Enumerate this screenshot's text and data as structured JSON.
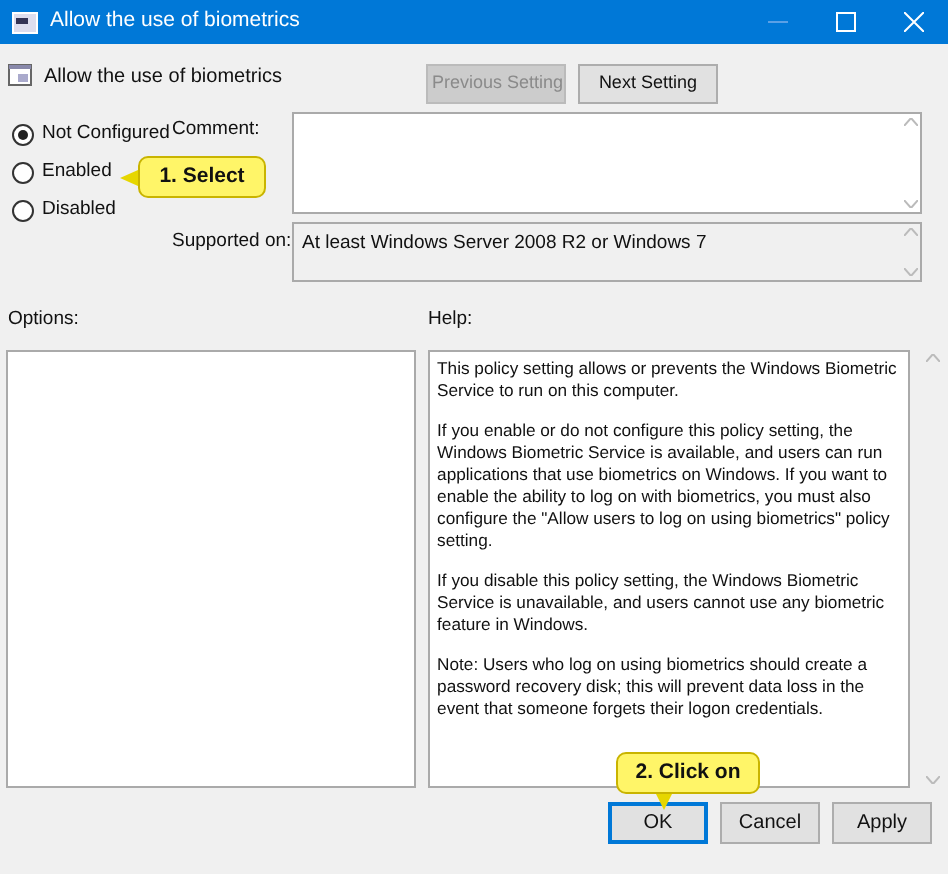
{
  "window": {
    "title": "Allow the use of biometrics"
  },
  "header": {
    "title": "Allow the use of biometrics",
    "buttons": [
      {
        "label": "Previous Setting",
        "disabled": true
      },
      {
        "label": "Next Setting",
        "disabled": false
      }
    ]
  },
  "state_options": [
    {
      "label": "Not Configured",
      "selected": true
    },
    {
      "label": "Enabled",
      "selected": false
    },
    {
      "label": "Disabled",
      "selected": false
    }
  ],
  "comment": {
    "label": "Comment:"
  },
  "supported_on": {
    "label": "Supported on:",
    "value": "At least Windows Server 2008 R2 or Windows 7"
  },
  "options": {
    "label": "Options:"
  },
  "help": {
    "label": "Help:",
    "paragraphs": [
      "This policy setting allows or prevents the Windows Biometric Service to run on this computer.",
      "If you enable or do not configure this policy setting, the Windows Biometric Service is available, and users can run applications that use biometrics on Windows. If you want to enable the ability to log on with biometrics, you must also configure the \"Allow users to log on using biometrics\" policy setting.",
      "If you disable this policy setting, the Windows Biometric Service is unavailable, and users cannot use any biometric feature in Windows.",
      "Note: Users who log on using biometrics should create a password recovery disk; this will prevent data loss in the event that someone forgets their logon credentials."
    ]
  },
  "footer_buttons": [
    {
      "label": "OK",
      "selected": true
    },
    {
      "label": "Cancel",
      "selected": false
    },
    {
      "label": "Apply",
      "selected": false
    }
  ],
  "callouts": [
    {
      "text": "1. Select"
    },
    {
      "text": "2. Click on"
    }
  ]
}
